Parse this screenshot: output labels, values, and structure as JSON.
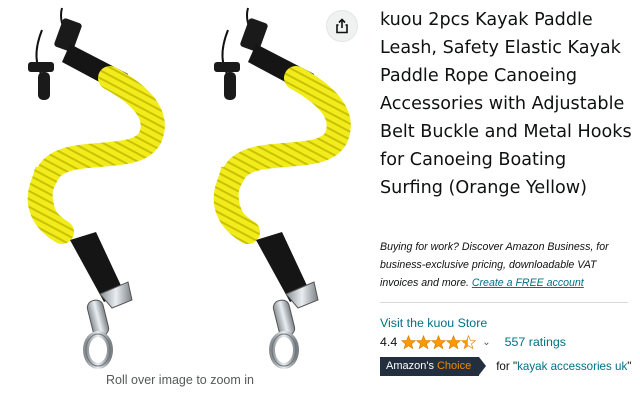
{
  "gallery": {
    "zoom_hint": "Roll over image to zoom in"
  },
  "product": {
    "title": "kuou 2pcs Kayak Paddle Leash, Safety Elastic Kayak Paddle Rope Canoeing Accessories with Adjustable Belt Buckle and Metal Hooks for Canoeing Boating Surfing (Orange Yellow)"
  },
  "business": {
    "text": "Buying for work? Discover Amazon Business, for business-exclusive pricing, downloadable VAT invoices and more.",
    "link": "Create a FREE account"
  },
  "store": {
    "link": "Visit the kuou Store"
  },
  "rating": {
    "value": "4.4",
    "stars": 4.4,
    "count": "557 ratings"
  },
  "badge": {
    "amazon": "Amazon's",
    "choice": "Choice",
    "for_prefix": "for \"",
    "keyword": "kayak accessories uk",
    "for_suffix": "\""
  },
  "colors": {
    "link": "#007185",
    "star": "#ff9900",
    "badge_bg": "#232f3e",
    "badge_accent": "#f08804",
    "leash_yellow": "#f2ec1c"
  },
  "icons": [
    "share-icon",
    "star-icon",
    "chevron-down-icon"
  ]
}
